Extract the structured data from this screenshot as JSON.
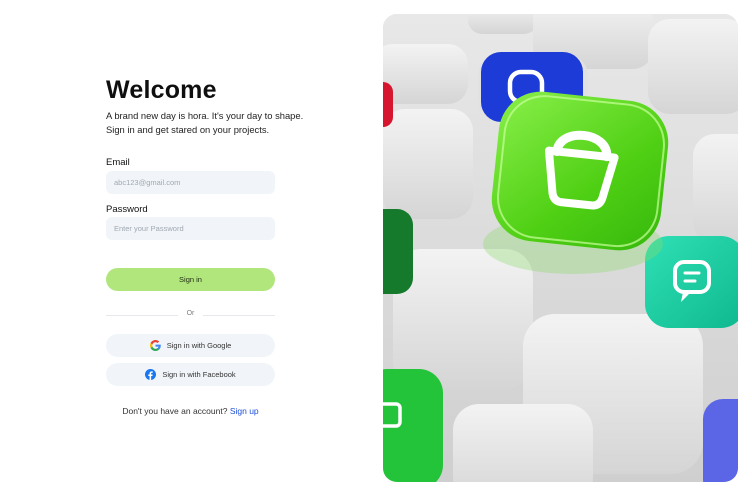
{
  "login": {
    "title": "Welcome",
    "subtitle": "A brand new day is hora. It's your day to shape. Sign in and get stared on your projects.",
    "email_label": "Email",
    "email_placeholder": "abc123@gmail.com",
    "password_label": "Password",
    "password_placeholder": "Enter your Password",
    "signin_label": "Sign in",
    "divider_text": "Or",
    "google_label": "Sign in with Google",
    "facebook_label": "Sign in with Facebook",
    "signup_prompt": "Don't you have an account?",
    "signup_link": "Sign up"
  },
  "colors": {
    "accent": "#b1e67d",
    "input_bg": "#f1f5f9",
    "link": "#1d4ed8"
  },
  "icons": {
    "google": "google-logo-icon",
    "facebook": "facebook-logo-icon",
    "hero": "3d-app-tiles-illustration"
  }
}
